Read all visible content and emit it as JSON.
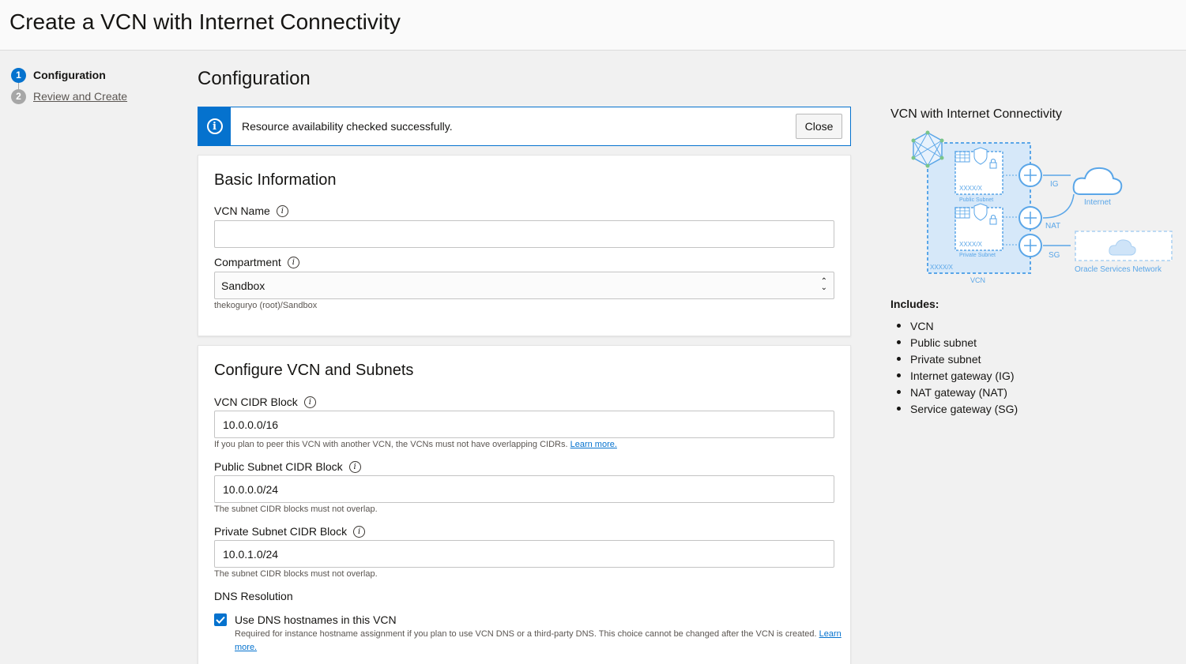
{
  "page": {
    "title": "Create a VCN with Internet Connectivity"
  },
  "steps": [
    {
      "number": "1",
      "label": "Configuration"
    },
    {
      "number": "2",
      "label": "Review and Create"
    }
  ],
  "main": {
    "title": "Configuration"
  },
  "alert": {
    "message": "Resource availability checked successfully.",
    "close_label": "Close"
  },
  "basic_info": {
    "title": "Basic Information",
    "vcn_name": {
      "label": "VCN Name",
      "value": ""
    },
    "compartment": {
      "label": "Compartment",
      "value": "Sandbox",
      "path": "thekoguryo (root)/Sandbox"
    }
  },
  "vcn_subnets": {
    "title": "Configure VCN and Subnets",
    "vcn_cidr": {
      "label": "VCN CIDR Block",
      "value": "10.0.0.0/16",
      "help": "If you plan to peer this VCN with another VCN, the VCNs must not have overlapping CIDRs.",
      "link": "Learn more."
    },
    "public_cidr": {
      "label": "Public Subnet CIDR Block",
      "value": "10.0.0.0/24",
      "help": "The subnet CIDR blocks must not overlap."
    },
    "private_cidr": {
      "label": "Private Subnet CIDR Block",
      "value": "10.0.1.0/24",
      "help": "The subnet CIDR blocks must not overlap."
    },
    "dns": {
      "label": "DNS Resolution",
      "checkbox_label": "Use DNS hostnames in this VCN",
      "checked": true,
      "desc": "Required for instance hostname assignment if you plan to use VCN DNS or a third-party DNS. This choice cannot be changed after the VCN is created.",
      "link": "Learn more."
    }
  },
  "side": {
    "title": "VCN with Internet Connectivity",
    "diagram": {
      "cidr_label": "XXXX/X",
      "public_subnet": "Public Subnet",
      "private_subnet": "Private Subnet",
      "vcn": "VCN",
      "ig": "IG",
      "nat": "NAT",
      "sg": "SG",
      "internet": "Internet",
      "oracle_services": "Oracle Services Network"
    },
    "includes_title": "Includes:",
    "includes": [
      "VCN",
      "Public subnet",
      "Private subnet",
      "Internet gateway (IG)",
      "NAT gateway (NAT)",
      "Service gateway (SG)"
    ]
  },
  "colors": {
    "accent": "#0572ce",
    "diagram_blue": "#5aa6e8",
    "diagram_fill": "#d6e8f9"
  }
}
